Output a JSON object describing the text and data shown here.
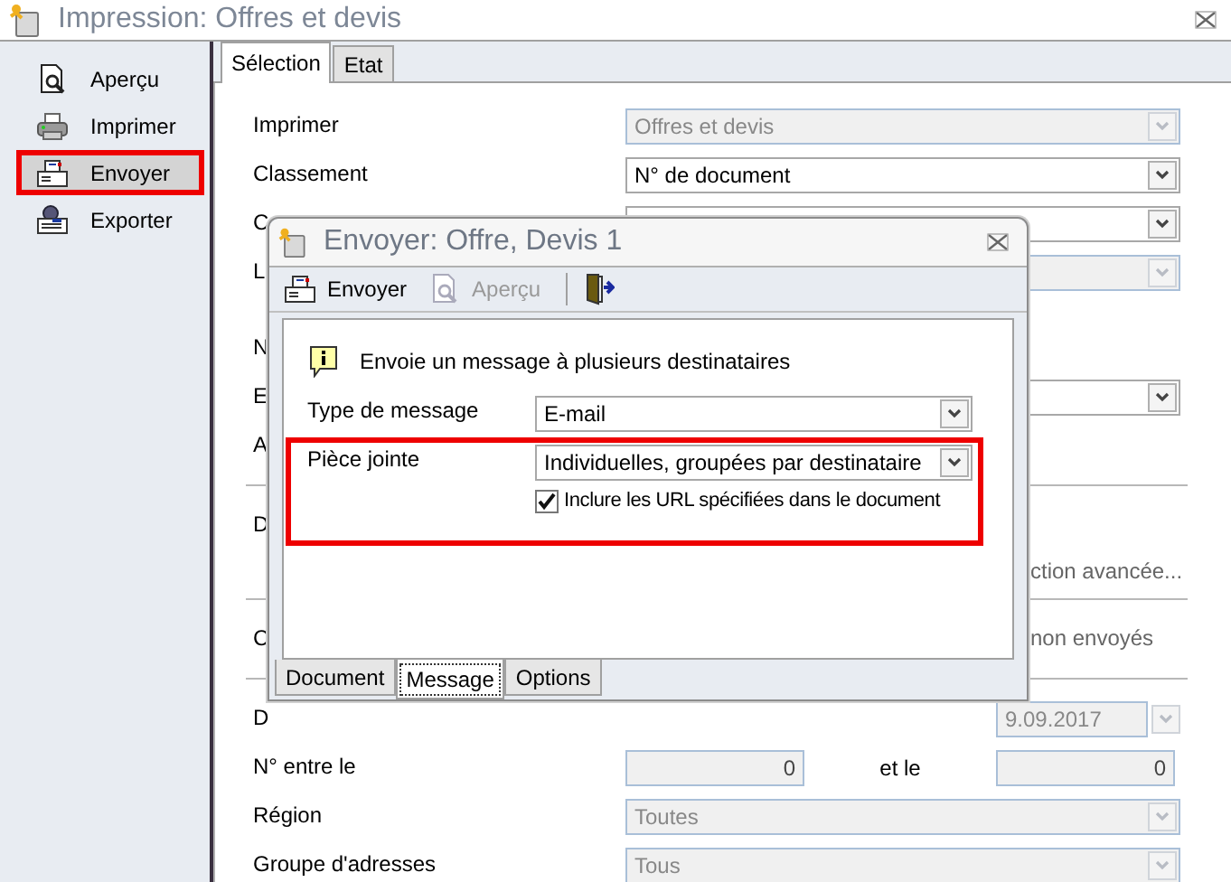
{
  "window": {
    "title": "Impression: Offres et devis"
  },
  "sidebar": {
    "items": [
      {
        "label": "Aperçu",
        "selected": false,
        "highlighted": false
      },
      {
        "label": "Imprimer",
        "selected": false,
        "highlighted": false
      },
      {
        "label": "Envoyer",
        "selected": true,
        "highlighted": true
      },
      {
        "label": "Exporter",
        "selected": false,
        "highlighted": false
      }
    ]
  },
  "tabs": [
    {
      "label": "Sélection",
      "selected": true
    },
    {
      "label": "Etat",
      "selected": false
    }
  ],
  "form": {
    "rows": [
      {
        "kind": "combo",
        "label": "Imprimer",
        "value": "Offres et devis",
        "disabled": true
      },
      {
        "kind": "combo",
        "label": "Classement",
        "value": "N° de document",
        "disabled": false
      },
      {
        "kind": "combo",
        "label": "C",
        "disabled": false
      },
      {
        "kind": "combo",
        "label": "L",
        "disabled": true
      },
      {
        "kind": "gap"
      },
      {
        "kind": "none",
        "label": "N"
      },
      {
        "kind": "combo",
        "label": "E",
        "disabled": false
      },
      {
        "kind": "none",
        "label": "A"
      },
      {
        "kind": "separator"
      },
      {
        "kind": "note",
        "label": "D",
        "note": "ction avancée..."
      },
      {
        "kind": "separator"
      },
      {
        "kind": "inline-note",
        "label": "C",
        "note": "non envoyés"
      },
      {
        "kind": "separator"
      },
      {
        "kind": "date",
        "label": "D",
        "value": "9.09.2017",
        "disabled": true
      },
      {
        "kind": "range",
        "label": "N° entre le",
        "from": "0",
        "middle": "et le",
        "to": "0",
        "disabled": true
      },
      {
        "kind": "combo",
        "label": "Région",
        "value": "Toutes",
        "disabled": true
      },
      {
        "kind": "combo",
        "label": "Groupe d'adresses",
        "value": "Tous",
        "disabled": true
      }
    ]
  },
  "dialog": {
    "title": "Envoyer: Offre, Devis 1",
    "toolbar": [
      {
        "kind": "send",
        "label": "Envoyer",
        "disabled": false
      },
      {
        "kind": "preview",
        "label": "Aperçu",
        "disabled": true
      },
      {
        "kind": "separator"
      },
      {
        "kind": "exit"
      }
    ],
    "info": "Envoie un message à plusieurs destinataires",
    "message_type": {
      "label": "Type de message",
      "value": "E-mail"
    },
    "attachment": {
      "highlighted": true,
      "label": "Pièce jointe",
      "value": "Individuelles, groupées par destinataire",
      "checkbox": {
        "label": "Inclure les URL spécifiées dans le document",
        "checked": true
      }
    },
    "tabs": [
      {
        "label": "Document",
        "selected": false
      },
      {
        "label": "Message",
        "selected": true
      },
      {
        "label": "Options",
        "selected": false
      }
    ]
  }
}
